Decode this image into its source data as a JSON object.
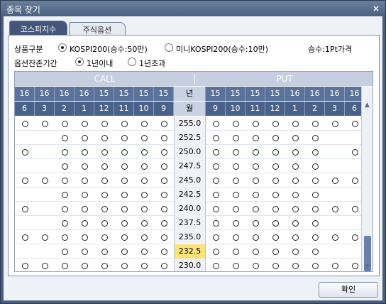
{
  "window": {
    "title": "종목 찾기",
    "close_glyph": "×"
  },
  "tabs": [
    {
      "label": "코스피지수",
      "active": true
    },
    {
      "label": "주식옵션",
      "active": false
    }
  ],
  "filters": {
    "product_label": "상품구분",
    "kospi200_label": "KOSPI200(승수:50만)",
    "mini_label": "미니KOSPI200(승수:10만)",
    "multiplier_note": "승수:1Pt가격",
    "remaining_label": "옵션잔존기간",
    "within1y_label": "1년이내",
    "over1y_label": "1년초과"
  },
  "table": {
    "call_label": "CALL",
    "put_label": "PUT",
    "year_label": "년",
    "month_label": "월",
    "call_years": [
      "16",
      "16",
      "16",
      "16",
      "15",
      "15",
      "15",
      "15"
    ],
    "call_months": [
      "6",
      "3",
      "2",
      "1",
      "12",
      "11",
      "10",
      "9"
    ],
    "put_years": [
      "15",
      "15",
      "15",
      "15",
      "16",
      "16",
      "16",
      "16"
    ],
    "put_months": [
      "9",
      "10",
      "11",
      "12",
      "1",
      "2",
      "3",
      "6"
    ],
    "rows": [
      {
        "strike": "255.0",
        "call": [
          1,
          1,
          1,
          1,
          1,
          1,
          1,
          1
        ],
        "put": [
          1,
          1,
          1,
          1,
          1,
          1,
          1,
          1
        ],
        "highlight": false
      },
      {
        "strike": "252.5",
        "call": [
          0,
          0,
          1,
          1,
          1,
          1,
          1,
          1
        ],
        "put": [
          1,
          1,
          1,
          1,
          1,
          1,
          0,
          0
        ],
        "highlight": false
      },
      {
        "strike": "250.0",
        "call": [
          1,
          0,
          1,
          1,
          1,
          1,
          1,
          1
        ],
        "put": [
          1,
          1,
          1,
          1,
          1,
          1,
          0,
          1
        ],
        "highlight": false
      },
      {
        "strike": "247.5",
        "call": [
          0,
          0,
          1,
          1,
          1,
          1,
          1,
          1
        ],
        "put": [
          1,
          1,
          1,
          1,
          1,
          1,
          0,
          0
        ],
        "highlight": false
      },
      {
        "strike": "245.0",
        "call": [
          1,
          1,
          1,
          1,
          1,
          1,
          1,
          1
        ],
        "put": [
          1,
          1,
          1,
          1,
          1,
          1,
          1,
          1
        ],
        "highlight": false
      },
      {
        "strike": "242.5",
        "call": [
          0,
          0,
          1,
          1,
          1,
          1,
          1,
          1
        ],
        "put": [
          1,
          1,
          1,
          1,
          1,
          1,
          0,
          0
        ],
        "highlight": false
      },
      {
        "strike": "240.0",
        "call": [
          1,
          0,
          1,
          1,
          1,
          1,
          1,
          1
        ],
        "put": [
          1,
          1,
          1,
          1,
          1,
          1,
          1,
          1
        ],
        "highlight": false
      },
      {
        "strike": "237.5",
        "call": [
          0,
          0,
          1,
          1,
          1,
          1,
          1,
          1
        ],
        "put": [
          1,
          1,
          1,
          1,
          1,
          1,
          0,
          0
        ],
        "highlight": false
      },
      {
        "strike": "235.0",
        "call": [
          1,
          1,
          1,
          1,
          1,
          1,
          1,
          1
        ],
        "put": [
          1,
          1,
          1,
          1,
          1,
          1,
          1,
          1
        ],
        "highlight": false
      },
      {
        "strike": "232.5",
        "call": [
          0,
          0,
          1,
          1,
          1,
          1,
          1,
          1
        ],
        "put": [
          1,
          1,
          1,
          1,
          1,
          1,
          0,
          0
        ],
        "highlight": true
      },
      {
        "strike": "230.0",
        "call": [
          1,
          1,
          1,
          1,
          1,
          1,
          1,
          1
        ],
        "put": [
          1,
          1,
          1,
          1,
          1,
          1,
          1,
          1
        ],
        "highlight": false
      }
    ]
  },
  "ok_button": {
    "label": "확인"
  }
}
